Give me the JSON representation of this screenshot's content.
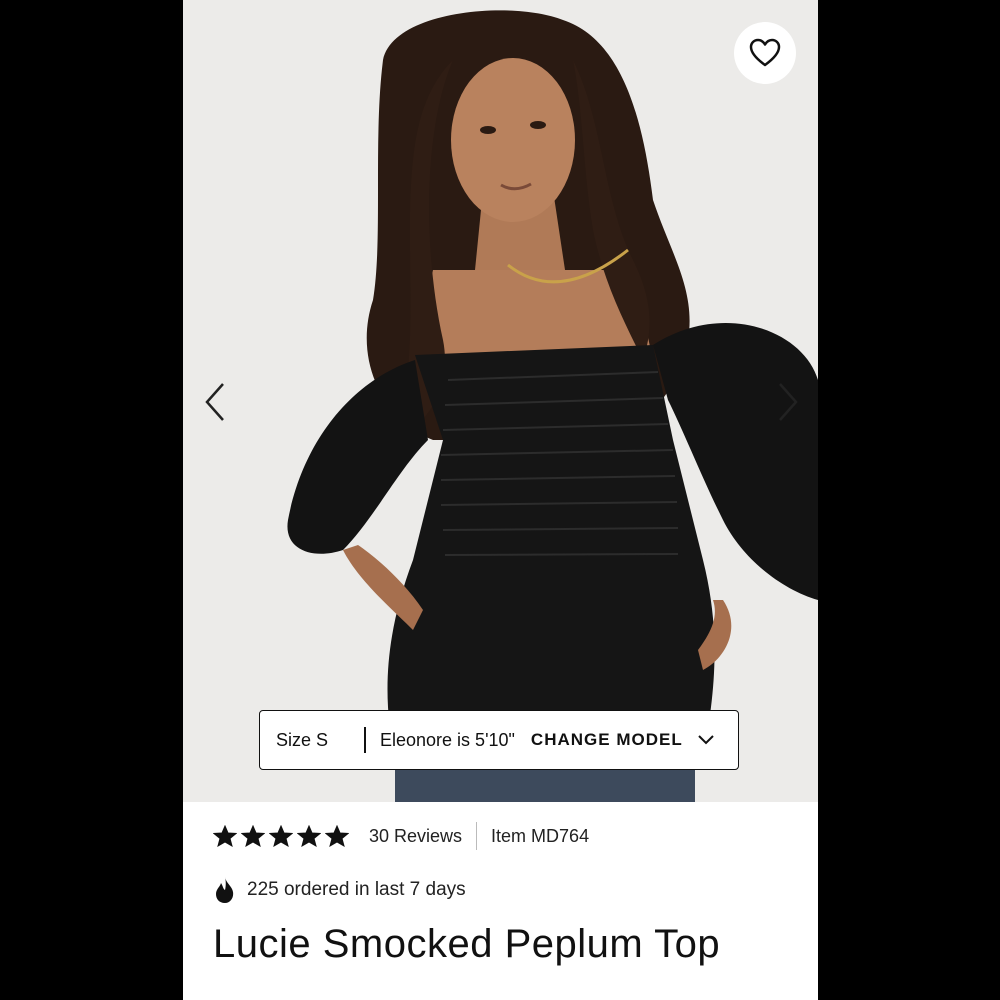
{
  "product": {
    "title": "Lucie Smocked Peplum Top",
    "rating": 5,
    "reviews_label": "30 Reviews",
    "item_label": "Item MD764",
    "orders_label": "225 ordered in last 7 days"
  },
  "model_info": {
    "size_label": "Size S",
    "model_desc": "Eleonore is 5'10\"",
    "change_label": "CHANGE MODEL"
  },
  "icons": {
    "favorite": "heart-icon",
    "prev": "chevron-left-icon",
    "next": "chevron-right-icon",
    "dropdown": "chevron-down-icon",
    "star": "star-icon",
    "trending": "flame-icon"
  },
  "colors": {
    "background": "#000000",
    "text": "#111111",
    "page": "#ffffff"
  }
}
